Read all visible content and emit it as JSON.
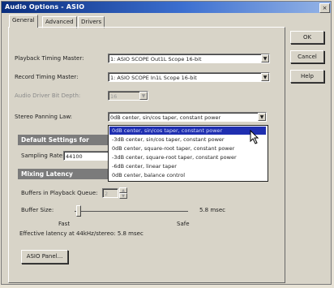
{
  "window": {
    "title": "Audio Options - ASIO",
    "close_glyph": "×"
  },
  "tabs": [
    "General",
    "Advanced",
    "Drivers"
  ],
  "side_buttons": {
    "ok": "OK",
    "cancel": "Cancel",
    "help": "Help"
  },
  "general": {
    "playback_label": "Playback Timing Master:",
    "playback_value": "1: ASIO SCOPE Out1L Scope 16-bit",
    "record_label": "Record Timing Master:",
    "record_value": "1: ASIO SCOPE In1L Scope 16-bit",
    "bitdepth_label": "Audio Driver Bit Depth:",
    "bitdepth_value": "16",
    "panning_label": "Stereo Panning Law:",
    "panning_value": "0dB center, sin/cos taper, constant power",
    "panning_options": [
      "0dB center, sin/cos taper, constant power",
      "-3dB center, sin/cos taper, constant power",
      "0dB center, square-root taper, constant power",
      "-3dB center, square-root taper, constant power",
      "-6dB center, linear taper",
      "0dB center, balance control"
    ],
    "defaults_header": "Default Settings for",
    "samplerate_label": "Sampling Rate:",
    "samplerate_value": "44100",
    "mixing_header": "Mixing Latency",
    "buffers_label": "Buffers in Playback Queue:",
    "buffers_value": "2",
    "buffersize_label": "Buffer Size:",
    "buffersize_value": "5.8 msec",
    "fast_label": "Fast",
    "safe_label": "Safe",
    "latency_text": "Effective latency at 44kHz/stereo:  5.8 msec",
    "asio_panel_button": "ASIO Panel..."
  },
  "icons": {
    "dropdown": "▼",
    "spin_up": "▲",
    "spin_down": "▼"
  }
}
